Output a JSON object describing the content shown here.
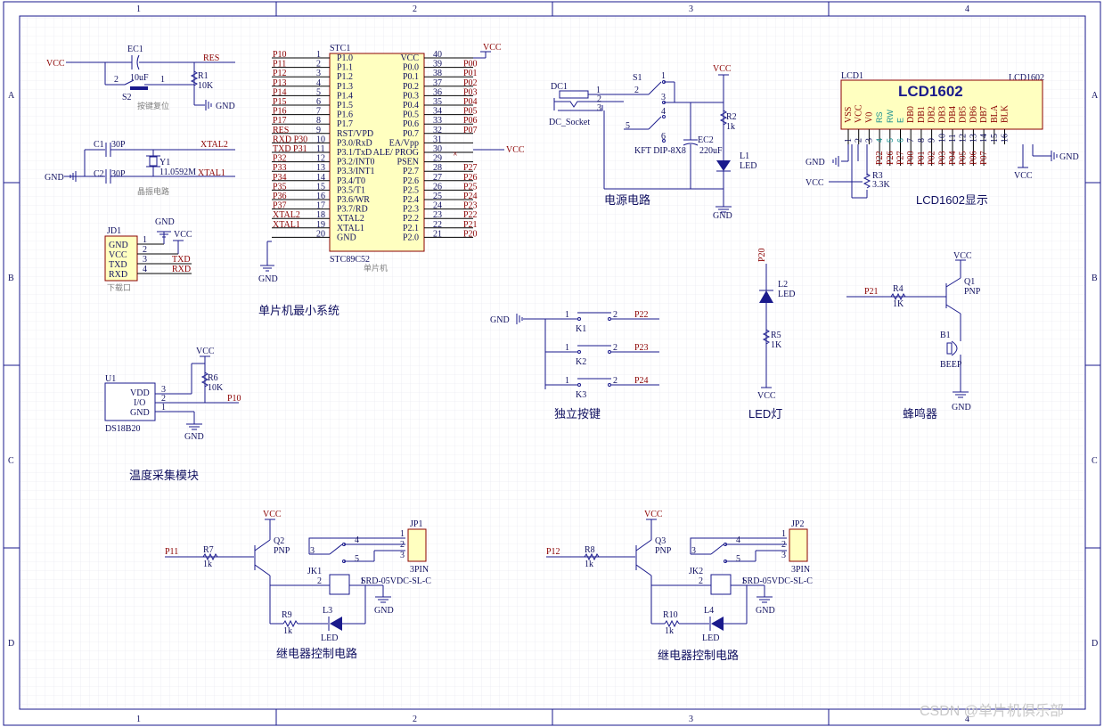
{
  "border": {
    "cols": [
      "1",
      "2",
      "3",
      "4"
    ],
    "rows": [
      "A",
      "B",
      "C",
      "D"
    ]
  },
  "sections": {
    "mcu_min": "单片机最小系统",
    "power": "电源电路",
    "lcd_disp": "LCD1602显示",
    "keys": "独立按键",
    "led": "LED灯",
    "buzzer": "蜂鸣器",
    "temp": "温度采集模块",
    "relay1": "继电器控制电路",
    "relay2": "继电器控制电路"
  },
  "reset": {
    "vcc": "VCC",
    "ec1": "EC1",
    "ec1_val": "10uF",
    "res": "RES",
    "r1": "R1",
    "r1_val": "10K",
    "s2": "S2",
    "gnd": "GND",
    "desc": "按键复位",
    "pin1": "1",
    "pin2": "2"
  },
  "crystal": {
    "c1": "C1",
    "c1_val": "30P",
    "c2": "C2",
    "c2_val": "30P",
    "y1": "Y1",
    "y1_val": "11.0592M",
    "xtal2": "XTAL2",
    "xtal1": "XTAL1",
    "gnd": "GND",
    "desc": "晶振电路"
  },
  "jd1": {
    "ref": "JD1",
    "pins": [
      "GND",
      "VCC",
      "TXD",
      "RXD"
    ],
    "nums": [
      "1",
      "2",
      "3",
      "4"
    ],
    "gnd": "GND",
    "vcc": "VCC",
    "txd": "TXD",
    "rxd": "RXD",
    "desc": "下载口"
  },
  "mcu": {
    "ref": "STC1",
    "part": "STC89C52",
    "desc": "单片机",
    "vcc": "VCC",
    "gnd": "GND",
    "vcc_net": "VCC",
    "left_nets": [
      "P10",
      "P11",
      "P12",
      "P13",
      "P14",
      "P15",
      "P16",
      "P17",
      "RES",
      "RXD P30",
      "TXD P31",
      "P32",
      "P33",
      "P34",
      "P35",
      "P36",
      "P37",
      "XTAL2",
      "XTAL1",
      ""
    ],
    "left_names": [
      "P1.0",
      "P1.1",
      "P1.2",
      "P1.3",
      "P1.4",
      "P1.5",
      "P1.6",
      "P1.7",
      "RST/VPD",
      "P3.0/RxD",
      "P3.1/TxD",
      "P3.2/INT0",
      "P3.3/INT1",
      "P3.4/T0",
      "P3.5/T1",
      "P3.6/WR",
      "P3.7/RD",
      "XTAL2",
      "XTAL1",
      "GND"
    ],
    "left_nums": [
      "1",
      "2",
      "3",
      "4",
      "5",
      "6",
      "7",
      "8",
      "9",
      "10",
      "11",
      "12",
      "13",
      "14",
      "15",
      "16",
      "17",
      "18",
      "19",
      "20"
    ],
    "right_names": [
      "VCC",
      "P0.0",
      "P0.1",
      "P0.2",
      "P0.3",
      "P0.4",
      "P0.5",
      "P0.6",
      "P0.7",
      "EA/Vpp",
      "ALE/ PROG",
      "PSEN",
      "P2.7",
      "P2.6",
      "P2.5",
      "P2.4",
      "P2.3",
      "P2.2",
      "P2.1",
      "P2.0"
    ],
    "right_nums": [
      "40",
      "39",
      "38",
      "37",
      "36",
      "35",
      "34",
      "33",
      "32",
      "31",
      "30",
      "29",
      "28",
      "27",
      "26",
      "25",
      "24",
      "23",
      "22",
      "21"
    ],
    "right_nets": [
      "",
      "P00",
      "P01",
      "P02",
      "P03",
      "P04",
      "P05",
      "P06",
      "P07",
      "",
      "",
      "",
      "P27",
      "P26",
      "P25",
      "P24",
      "P23",
      "P22",
      "P21",
      "P20"
    ]
  },
  "power": {
    "dc1": "DC1",
    "socket": "DC_Socket",
    "s1": "S1",
    "switch": "KFT DIP-8X8",
    "vcc": "VCC",
    "r2": "R2",
    "r2_val": "1k",
    "ec2": "EC2",
    "ec2_val": "220uF",
    "l1": "L1",
    "l1_val": "LED",
    "gnd": "GND",
    "nums": [
      "1",
      "2",
      "3",
      "2",
      "1",
      "3",
      "4",
      "5",
      "6"
    ]
  },
  "lcd": {
    "ref": "LCD1",
    "ref2": "LCD1602",
    "title": "LCD1602",
    "pins": [
      "VSS",
      "VCC",
      "V0",
      "RS",
      "RW",
      "E",
      "DB0",
      "DB1",
      "DB2",
      "DB3",
      "DB4",
      "DB5",
      "DB6",
      "DB7",
      "BLA",
      "BLK"
    ],
    "nums": [
      "1",
      "2",
      "3",
      "4",
      "5",
      "6",
      "7",
      "8",
      "9",
      "10",
      "11",
      "12",
      "13",
      "14",
      "15",
      "16"
    ],
    "nets": [
      "",
      "",
      "",
      "P22",
      "P26",
      "P27",
      "P00",
      "P01",
      "P02",
      "P03",
      "P04",
      "P05",
      "P06",
      "P07",
      "",
      ""
    ],
    "gnd": "GND",
    "vcc": "VCC",
    "r3": "R3",
    "r3_val": "3.3K",
    "vcc2": "VCC",
    "gnd2": "GND"
  },
  "keys": {
    "gnd": "GND",
    "items": [
      {
        "ref": "K1",
        "net": "P22"
      },
      {
        "ref": "K2",
        "net": "P23"
      },
      {
        "ref": "K3",
        "net": "P24"
      }
    ],
    "n1": "1",
    "n2": "2"
  },
  "led": {
    "net": "P20",
    "ref": "L2",
    "val": "LED",
    "r": "R5",
    "r_val": "1K",
    "vcc": "VCC"
  },
  "buzzer": {
    "vcc": "VCC",
    "q": "Q1",
    "q_val": "PNP",
    "net": "P21",
    "r": "R4",
    "r_val": "1K",
    "b": "B1",
    "b_val": "BEEP",
    "gnd": "GND"
  },
  "temp": {
    "ref": "U1",
    "part": "DS18B20",
    "pins": [
      "VDD",
      "I/O",
      "GND"
    ],
    "nums": [
      "3",
      "2",
      "1"
    ],
    "vcc": "VCC",
    "r": "R6",
    "r_val": "10K",
    "net": "P10",
    "gnd": "GND"
  },
  "relay1": {
    "net": "P11",
    "r": "R7",
    "r_val": "1k",
    "vcc": "VCC",
    "q": "Q2",
    "q_val": "PNP",
    "jk": "JK1",
    "relay": "SRD-05VDC-SL-C",
    "jp": "JP1",
    "jp_val": "3PIN",
    "gnd": "GND",
    "r2": "R9",
    "r2_val": "1k",
    "l": "L3",
    "l_val": "LED"
  },
  "relay2": {
    "net": "P12",
    "r": "R8",
    "r_val": "1k",
    "vcc": "VCC",
    "q": "Q3",
    "q_val": "PNP",
    "jk": "JK2",
    "relay": "SRD-05VDC-SL-C",
    "jp": "JP2",
    "jp_val": "3PIN",
    "gnd": "GND",
    "r2": "R10",
    "r2_val": "1k",
    "l": "L4",
    "l_val": "LED"
  },
  "relay_nums": [
    "1",
    "2",
    "3",
    "4",
    "5",
    "1",
    "2",
    "3"
  ],
  "watermark": "CSDN @单片机俱乐部",
  "colors": {
    "wire": "#1a1a8c",
    "net": "#8b0000",
    "chip": "#ffffc0",
    "border": "#1a1a8c",
    "grid": "#e4e4ee"
  }
}
